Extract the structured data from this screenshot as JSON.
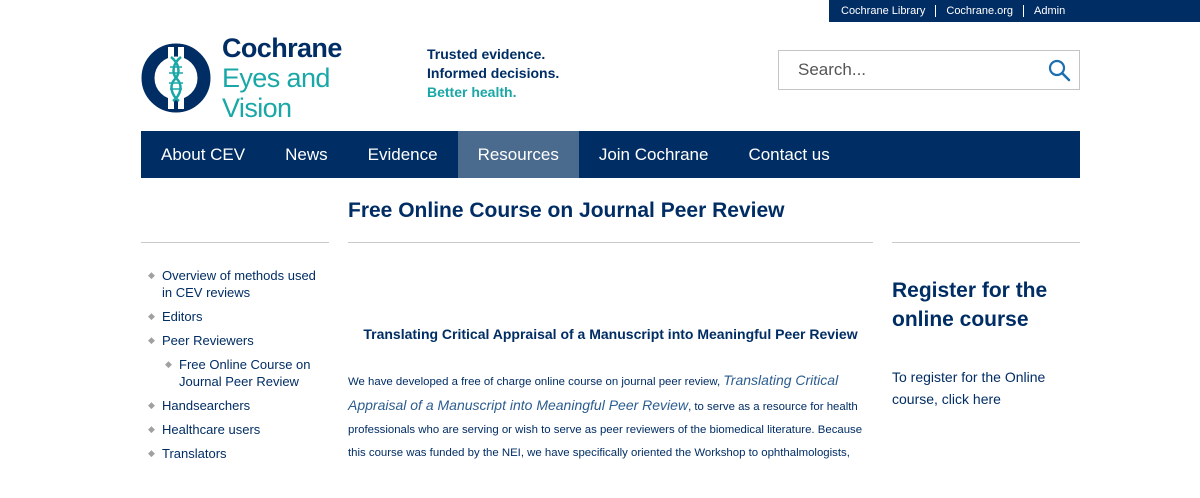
{
  "utility_nav": [
    "Cochrane Library",
    "Cochrane.org",
    "Admin"
  ],
  "logo": {
    "title": "Cochrane",
    "subtitle": "Eyes and Vision"
  },
  "tagline": [
    "Trusted evidence.",
    "Informed decisions.",
    "Better health."
  ],
  "search": {
    "placeholder": "Search...",
    "value": ""
  },
  "nav": {
    "items": [
      "About CEV",
      "News",
      "Evidence",
      "Resources",
      "Join Cochrane",
      "Contact us"
    ],
    "active": "Resources"
  },
  "page_title": "Free Online Course on Journal Peer Review",
  "sidebar": [
    {
      "label": "Overview of methods used in CEV reviews"
    },
    {
      "label": "Editors"
    },
    {
      "label": "Peer Reviewers"
    },
    {
      "label": "Free Online Course on Journal Peer Review"
    },
    {
      "label": "Handsearchers"
    },
    {
      "label": "Healthcare users"
    },
    {
      "label": "Translators"
    }
  ],
  "article": {
    "heading": "Translating Critical Appraisal of a Manuscript into Meaningful Peer Review",
    "p_start": "We have developed a free of charge online course on journal peer review, ",
    "p_link": "Translating Critical Appraisal of a Manuscript into Meaningful Peer Review",
    "p_end": ", to serve as a resource for health professionals who are serving or wish to serve as peer reviewers of the biomedical literature. Because this course was funded by the NEI, we have specifically oriented the Workshop to ophthalmologists,"
  },
  "register": {
    "heading": "Register for the online course",
    "link": "To register for the Online course, click here"
  },
  "colors": {
    "navy": "#002d64",
    "teal": "#1aa7a7",
    "active_nav": "#4a6a8e"
  },
  "icons": [
    "cochrane-logo-icon",
    "search-icon",
    "bullet-icon"
  ]
}
